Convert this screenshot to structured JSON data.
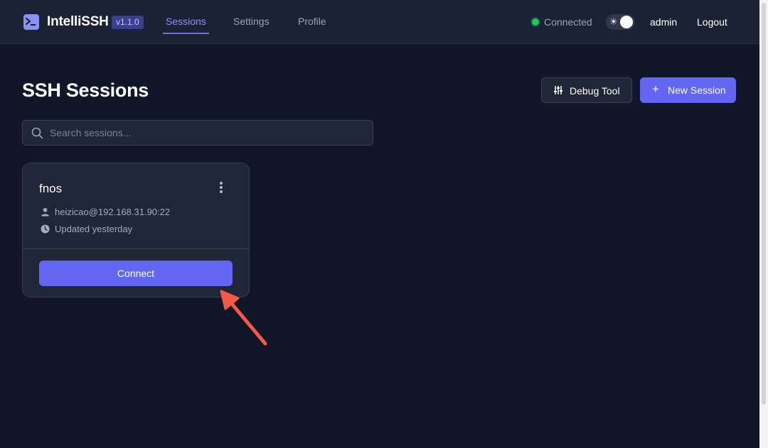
{
  "app": {
    "name": "IntelliSSH",
    "version": "v1.1.0"
  },
  "nav": {
    "items": [
      {
        "label": "Sessions",
        "active": true
      },
      {
        "label": "Settings",
        "active": false
      },
      {
        "label": "Profile",
        "active": false
      }
    ]
  },
  "header_right": {
    "status": "Connected",
    "status_color": "#22c55e",
    "theme_icon": "sun-icon",
    "username": "admin",
    "logout_label": "Logout"
  },
  "page": {
    "title": "SSH Sessions",
    "debug_label": "Debug Tool",
    "debug_icon": "sliders-icon",
    "new_label": "New Session",
    "new_icon": "plus-icon"
  },
  "search": {
    "placeholder": "Search sessions...",
    "value": ""
  },
  "sessions": [
    {
      "name": "fnos",
      "host": "heizicao@192.168.31.90:22",
      "updated": "Updated yesterday",
      "connect_label": "Connect"
    }
  ],
  "colors": {
    "accent": "#6366f1",
    "background": "#111729",
    "annotation_arrow": "#f05a47"
  }
}
